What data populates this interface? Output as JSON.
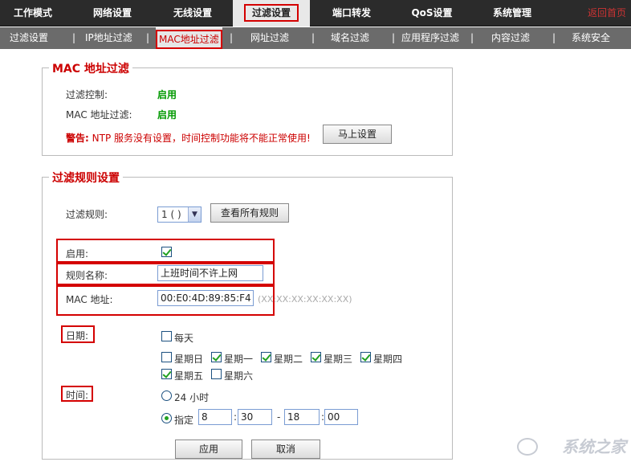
{
  "topnav": {
    "items": [
      "工作模式",
      "网络设置",
      "无线设置",
      "过滤设置",
      "端口转发",
      "QoS设置",
      "系统管理"
    ],
    "home": "返回首页"
  },
  "subnav": {
    "items": [
      "过滤设置",
      "IP地址过滤",
      "MAC地址过滤",
      "网址过滤",
      "域名过滤",
      "应用程序过滤",
      "内容过滤",
      "系统安全"
    ]
  },
  "mac_filter": {
    "legend": "MAC 地址过滤",
    "control_label": "过滤控制:",
    "control_value": "启用",
    "mac_label": "MAC 地址过滤:",
    "mac_value": "启用",
    "warning_prefix": "警告:",
    "warning_text": "NTP 服务没有设置，时间控制功能将不能正常使用!",
    "setup_button": "马上设置"
  },
  "rule": {
    "legend": "过滤规则设置",
    "rule_label": "过滤规则:",
    "rule_select": "1 ( )",
    "view_all_button": "查看所有规则",
    "enable_label": "启用:",
    "enable_checked": true,
    "name_label": "规则名称:",
    "name_value": "上班时间不许上网",
    "mac_label": "MAC 地址:",
    "mac_value": "00:E0:4D:89:85:F4",
    "mac_hint": "(XX:XX:XX:XX:XX:XX)",
    "date_label": "日期:",
    "everyday": "每天",
    "days": [
      {
        "label": "星期日",
        "checked": false
      },
      {
        "label": "星期一",
        "checked": true
      },
      {
        "label": "星期二",
        "checked": true
      },
      {
        "label": "星期三",
        "checked": true
      },
      {
        "label": "星期四",
        "checked": true
      },
      {
        "label": "星期五",
        "checked": true
      },
      {
        "label": "星期六",
        "checked": false
      }
    ],
    "time_label": "时间:",
    "h24": "24 小时",
    "specify": "指定",
    "start_hour": "8",
    "start_min": "30",
    "dash": "-",
    "colon": ":",
    "end_hour": "18",
    "end_min": "00",
    "apply_button": "应用",
    "cancel_button": "取消"
  },
  "watermark": "系统之家"
}
